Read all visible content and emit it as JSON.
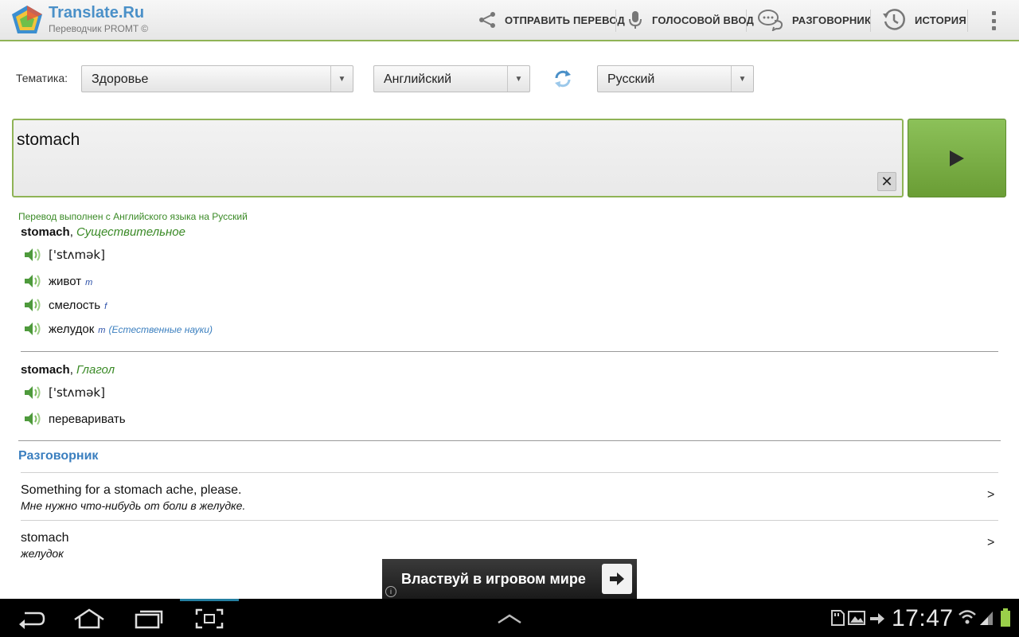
{
  "app": {
    "title": "Translate.Ru",
    "subtitle": "Переводчик PROMT ©"
  },
  "actions": [
    {
      "label": "ОТПРАВИТЬ ПЕРЕВОД",
      "icon": "share-icon"
    },
    {
      "label": "ГОЛОСОВОЙ ВВОД",
      "icon": "microphone-icon"
    },
    {
      "label": "РАЗГОВОРНИК",
      "icon": "chat-bubbles-icon"
    },
    {
      "label": "ИСТОРИЯ",
      "icon": "history-clock-icon"
    }
  ],
  "settings": {
    "topic_label": "Тематика:",
    "topic_value": "Здоровье",
    "source_lang": "Английский",
    "target_lang": "Русский"
  },
  "input": {
    "value": "stomach",
    "clear_label": "✕"
  },
  "result": {
    "note": "Перевод выполнен с Английского языка на Русский",
    "entries": [
      {
        "word": "stomach",
        "pos": "Существительное",
        "transcription": "['stʌmək]",
        "translations": [
          {
            "text": "живот",
            "gender": "m",
            "domain": ""
          },
          {
            "text": "смелость",
            "gender": "f",
            "domain": ""
          },
          {
            "text": "желудок",
            "gender": "m",
            "domain": "(Естественные науки)"
          }
        ]
      },
      {
        "word": "stomach",
        "pos": "Глагол",
        "transcription": "['stʌmək]",
        "translations": [
          {
            "text": "переваривать",
            "gender": "",
            "domain": ""
          }
        ]
      }
    ]
  },
  "phrasebook": {
    "title": "Разговорник",
    "items": [
      {
        "en": "Something for a stomach ache, please.",
        "ru": "Мне нужно что-нибудь от боли в желудке.",
        "chevron": ">"
      },
      {
        "en": "stomach",
        "ru": "желудок",
        "chevron": ">"
      }
    ]
  },
  "ad": {
    "text": "Властвуй в игровом мире",
    "info": "i"
  },
  "system": {
    "clock": "17:47"
  },
  "colors": {
    "accent_green": "#8fb356",
    "link_blue": "#3b7fbf",
    "note_green": "#3a8a26"
  }
}
